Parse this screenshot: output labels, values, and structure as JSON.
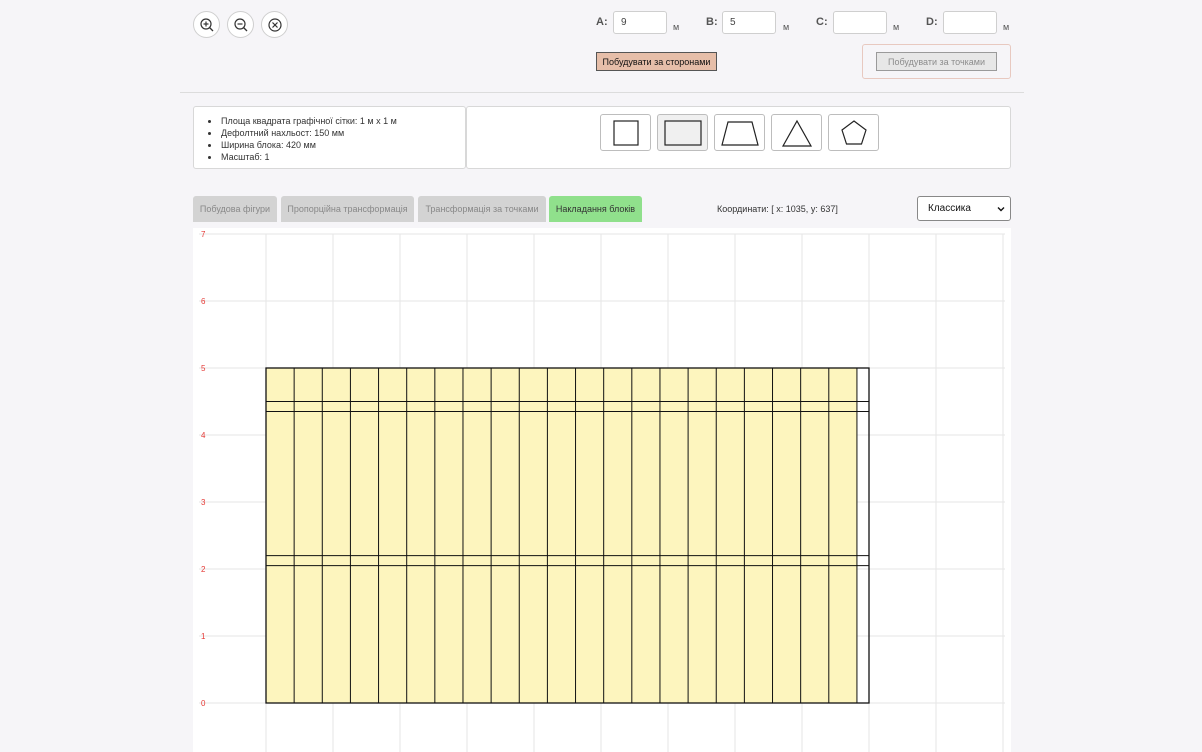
{
  "toolbar": {
    "zoom_in_icon": "zoom-in-icon",
    "zoom_out_icon": "zoom-out-icon",
    "clear_icon": "close-circle-icon"
  },
  "sides": [
    {
      "label": "A:",
      "value": "9",
      "unit": "м"
    },
    {
      "label": "B:",
      "value": "5",
      "unit": "м"
    },
    {
      "label": "C:",
      "value": "",
      "unit": "м"
    },
    {
      "label": "D:",
      "value": "",
      "unit": "м"
    }
  ],
  "buttons": {
    "build_by_sides": "Побудувати за сторонами",
    "build_by_points": "Побудувати за точками"
  },
  "info": [
    "Площа квадрата графічної сітки: 1 м x 1 м",
    "Дефолтний нахльост: 150 мм",
    "Ширина блока: 420 мм",
    "Масштаб: 1"
  ],
  "shapes": [
    {
      "name": "square",
      "active": false
    },
    {
      "name": "rectangle",
      "active": true
    },
    {
      "name": "trapezoid",
      "active": false
    },
    {
      "name": "triangle",
      "active": false
    },
    {
      "name": "pentagon",
      "active": false
    }
  ],
  "tabs": [
    {
      "label": "Побудова фігури",
      "active": false
    },
    {
      "label": "Пропорційна трансформація",
      "active": false
    },
    {
      "label": "Трансформація за точками",
      "active": false
    },
    {
      "label": "Накладання блоків",
      "active": true
    }
  ],
  "coords": {
    "prefix": "Координати: [ ",
    "x": "x: 1035",
    "sep": ", ",
    "y": "y: 637",
    "suffix": "]"
  },
  "mode_select": {
    "value": "Классика"
  },
  "grid": {
    "y_labels": [
      "7",
      "6",
      "5",
      "4",
      "3",
      "2",
      "1",
      "0"
    ],
    "label_color": "#e53935",
    "figure_width_m": 9,
    "figure_height_m": 5,
    "block_width_mm": 420,
    "overlap_mm": 150,
    "block_fill": "#fdf5be",
    "outline_color": "#111111",
    "grid_color": "#e6e6e6"
  }
}
